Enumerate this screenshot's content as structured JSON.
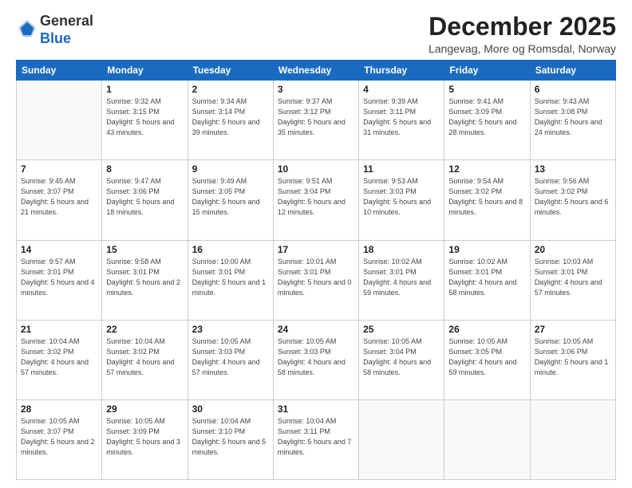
{
  "logo": {
    "general": "General",
    "blue": "Blue"
  },
  "header": {
    "month_title": "December 2025",
    "location": "Langevag, More og Romsdal, Norway"
  },
  "weekdays": [
    "Sunday",
    "Monday",
    "Tuesday",
    "Wednesday",
    "Thursday",
    "Friday",
    "Saturday"
  ],
  "weeks": [
    [
      {
        "day": "",
        "info": ""
      },
      {
        "day": "1",
        "info": "Sunrise: 9:32 AM\nSunset: 3:15 PM\nDaylight: 5 hours\nand 43 minutes."
      },
      {
        "day": "2",
        "info": "Sunrise: 9:34 AM\nSunset: 3:14 PM\nDaylight: 5 hours\nand 39 minutes."
      },
      {
        "day": "3",
        "info": "Sunrise: 9:37 AM\nSunset: 3:12 PM\nDaylight: 5 hours\nand 35 minutes."
      },
      {
        "day": "4",
        "info": "Sunrise: 9:39 AM\nSunset: 3:11 PM\nDaylight: 5 hours\nand 31 minutes."
      },
      {
        "day": "5",
        "info": "Sunrise: 9:41 AM\nSunset: 3:09 PM\nDaylight: 5 hours\nand 28 minutes."
      },
      {
        "day": "6",
        "info": "Sunrise: 9:43 AM\nSunset: 3:08 PM\nDaylight: 5 hours\nand 24 minutes."
      }
    ],
    [
      {
        "day": "7",
        "info": "Sunrise: 9:45 AM\nSunset: 3:07 PM\nDaylight: 5 hours\nand 21 minutes."
      },
      {
        "day": "8",
        "info": "Sunrise: 9:47 AM\nSunset: 3:06 PM\nDaylight: 5 hours\nand 18 minutes."
      },
      {
        "day": "9",
        "info": "Sunrise: 9:49 AM\nSunset: 3:05 PM\nDaylight: 5 hours\nand 15 minutes."
      },
      {
        "day": "10",
        "info": "Sunrise: 9:51 AM\nSunset: 3:04 PM\nDaylight: 5 hours\nand 12 minutes."
      },
      {
        "day": "11",
        "info": "Sunrise: 9:53 AM\nSunset: 3:03 PM\nDaylight: 5 hours\nand 10 minutes."
      },
      {
        "day": "12",
        "info": "Sunrise: 9:54 AM\nSunset: 3:02 PM\nDaylight: 5 hours\nand 8 minutes."
      },
      {
        "day": "13",
        "info": "Sunrise: 9:56 AM\nSunset: 3:02 PM\nDaylight: 5 hours\nand 6 minutes."
      }
    ],
    [
      {
        "day": "14",
        "info": "Sunrise: 9:57 AM\nSunset: 3:01 PM\nDaylight: 5 hours\nand 4 minutes."
      },
      {
        "day": "15",
        "info": "Sunrise: 9:58 AM\nSunset: 3:01 PM\nDaylight: 5 hours\nand 2 minutes."
      },
      {
        "day": "16",
        "info": "Sunrise: 10:00 AM\nSunset: 3:01 PM\nDaylight: 5 hours\nand 1 minute."
      },
      {
        "day": "17",
        "info": "Sunrise: 10:01 AM\nSunset: 3:01 PM\nDaylight: 5 hours\nand 0 minutes."
      },
      {
        "day": "18",
        "info": "Sunrise: 10:02 AM\nSunset: 3:01 PM\nDaylight: 4 hours\nand 59 minutes."
      },
      {
        "day": "19",
        "info": "Sunrise: 10:02 AM\nSunset: 3:01 PM\nDaylight: 4 hours\nand 58 minutes."
      },
      {
        "day": "20",
        "info": "Sunrise: 10:03 AM\nSunset: 3:01 PM\nDaylight: 4 hours\nand 57 minutes."
      }
    ],
    [
      {
        "day": "21",
        "info": "Sunrise: 10:04 AM\nSunset: 3:02 PM\nDaylight: 4 hours\nand 57 minutes."
      },
      {
        "day": "22",
        "info": "Sunrise: 10:04 AM\nSunset: 3:02 PM\nDaylight: 4 hours\nand 57 minutes."
      },
      {
        "day": "23",
        "info": "Sunrise: 10:05 AM\nSunset: 3:03 PM\nDaylight: 4 hours\nand 57 minutes."
      },
      {
        "day": "24",
        "info": "Sunrise: 10:05 AM\nSunset: 3:03 PM\nDaylight: 4 hours\nand 58 minutes."
      },
      {
        "day": "25",
        "info": "Sunrise: 10:05 AM\nSunset: 3:04 PM\nDaylight: 4 hours\nand 58 minutes."
      },
      {
        "day": "26",
        "info": "Sunrise: 10:05 AM\nSunset: 3:05 PM\nDaylight: 4 hours\nand 59 minutes."
      },
      {
        "day": "27",
        "info": "Sunrise: 10:05 AM\nSunset: 3:06 PM\nDaylight: 5 hours\nand 1 minute."
      }
    ],
    [
      {
        "day": "28",
        "info": "Sunrise: 10:05 AM\nSunset: 3:07 PM\nDaylight: 5 hours\nand 2 minutes."
      },
      {
        "day": "29",
        "info": "Sunrise: 10:05 AM\nSunset: 3:09 PM\nDaylight: 5 hours\nand 3 minutes."
      },
      {
        "day": "30",
        "info": "Sunrise: 10:04 AM\nSunset: 3:10 PM\nDaylight: 5 hours\nand 5 minutes."
      },
      {
        "day": "31",
        "info": "Sunrise: 10:04 AM\nSunset: 3:11 PM\nDaylight: 5 hours\nand 7 minutes."
      },
      {
        "day": "",
        "info": ""
      },
      {
        "day": "",
        "info": ""
      },
      {
        "day": "",
        "info": ""
      }
    ]
  ]
}
